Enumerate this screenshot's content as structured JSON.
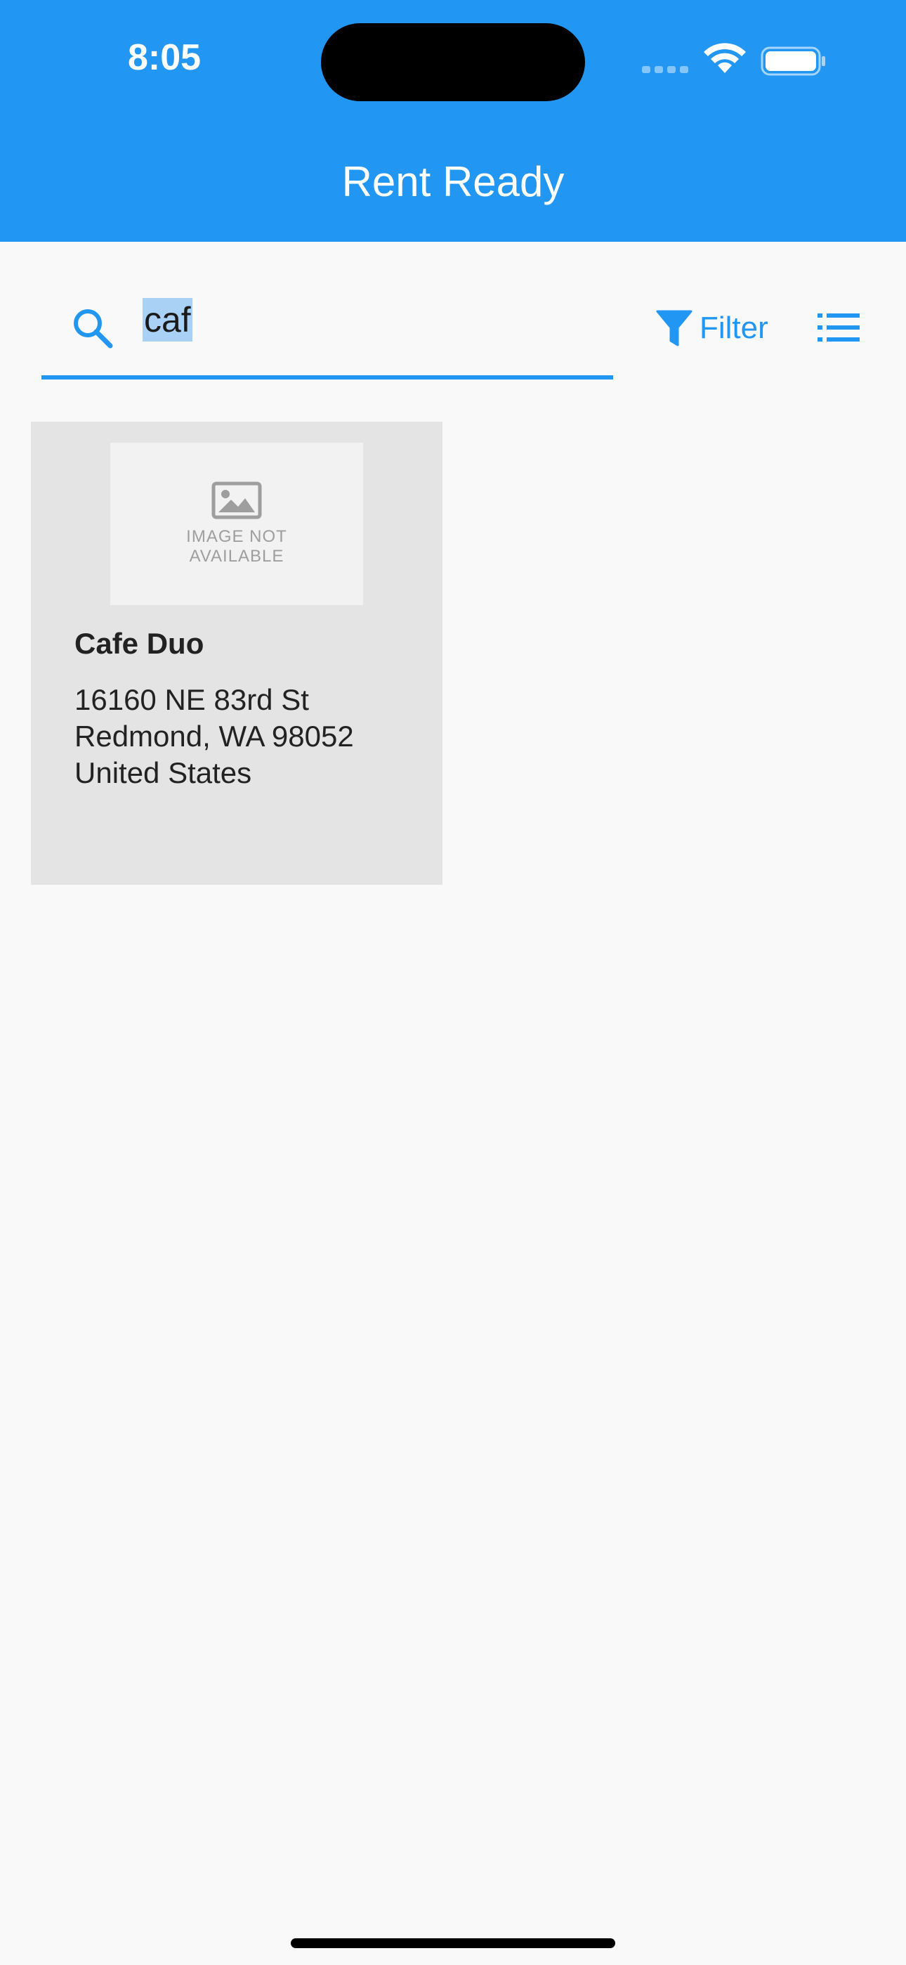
{
  "status_bar": {
    "time": "8:05"
  },
  "header": {
    "title": "Rent Ready"
  },
  "search": {
    "value": "caf",
    "icon": "search-icon"
  },
  "toolbar": {
    "filter_label": "Filter",
    "filter_icon": "filter-icon",
    "list_icon": "list-view-icon"
  },
  "results": [
    {
      "name": "Cafe Duo",
      "image_placeholder": "IMAGE NOT\nAVAILABLE",
      "address_lines": [
        "16160 NE 83rd St",
        "Redmond, WA 98052",
        "United States"
      ]
    }
  ],
  "colors": {
    "primary": "#2196f3",
    "card_background": "#e4e4e4",
    "page_background": "#f9f9f9",
    "selection_highlight": "#a9d0f5"
  }
}
